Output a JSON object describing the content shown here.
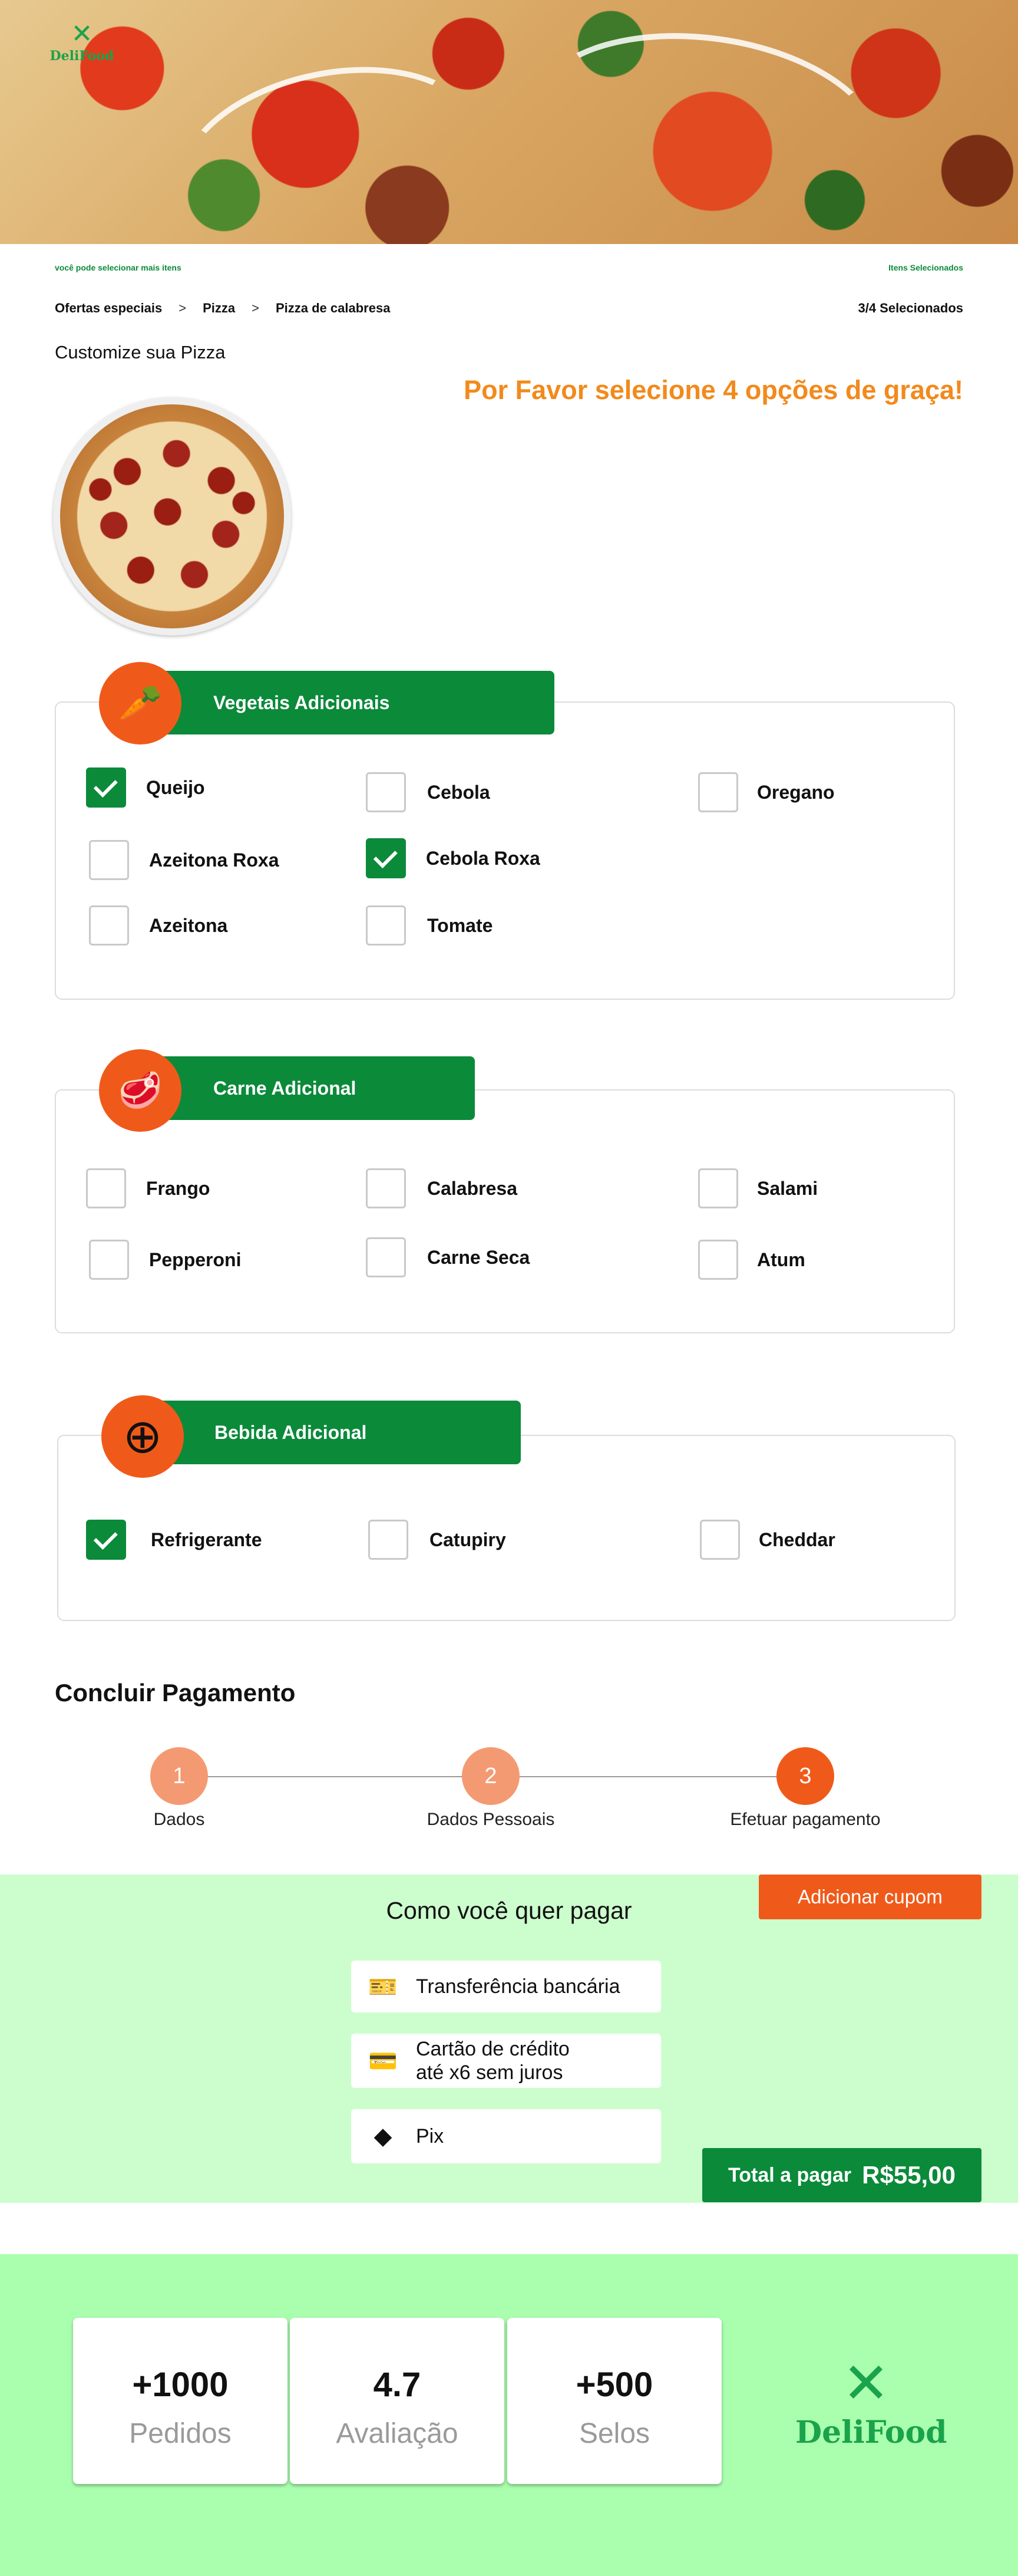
{
  "brand": {
    "name": "DeliFood",
    "logo_icon": "fork-knife-icon",
    "primary_color": "#0b8a3a",
    "accent_color": "#ef5a1a",
    "promo_color": "#f28a1c"
  },
  "header": {
    "hint_left": "você pode selecionar mais itens",
    "hint_right": "Itens Selecionados",
    "breadcrumb": [
      "Ofertas especiais",
      "Pizza",
      "Pizza de calabresa"
    ],
    "counter": "3/4 Selecionados",
    "customize_title": "Customize sua Pizza",
    "promo": "Por Favor selecione 4 opções de graça!"
  },
  "sections": [
    {
      "title": "Vegetais Adicionais",
      "icon": "carrot-icon",
      "options": [
        {
          "label": "Queijo",
          "checked": true
        },
        {
          "label": "Cebola",
          "checked": false
        },
        {
          "label": "Oregano",
          "checked": false
        },
        {
          "label": "Azeitona Roxa",
          "checked": false
        },
        {
          "label": "Cebola Roxa",
          "checked": true
        },
        {
          "label": "Azeitona",
          "checked": false
        },
        {
          "label": "Tomate",
          "checked": false
        }
      ]
    },
    {
      "title": "Carne Adicional",
      "icon": "steak-icon",
      "options": [
        {
          "label": "Frango",
          "checked": false
        },
        {
          "label": "Calabresa",
          "checked": false
        },
        {
          "label": "Salami",
          "checked": false
        },
        {
          "label": "Pepperoni",
          "checked": false
        },
        {
          "label": "Carne Seca",
          "checked": false
        },
        {
          "label": "Atum",
          "checked": false
        }
      ]
    },
    {
      "title": "Bebida Adicional",
      "icon": "plus-circle-icon",
      "options": [
        {
          "label": "Refrigerante",
          "checked": true
        },
        {
          "label": "Catupiry",
          "checked": false
        },
        {
          "label": "Cheddar",
          "checked": false
        }
      ]
    }
  ],
  "payment": {
    "title": "Concluir Pagamento",
    "steps": [
      {
        "number": "1",
        "label": "Dados",
        "state": "done"
      },
      {
        "number": "2",
        "label": "Dados Pessoais",
        "state": "done"
      },
      {
        "number": "3",
        "label": "Efetuar pagamento",
        "state": "active"
      }
    ],
    "coupon_label": "Adicionar cupom",
    "question": "Como você quer pagar",
    "methods": [
      {
        "label": "Transferência bancária",
        "icon": "ticket-icon"
      },
      {
        "label": "Cartão de crédito",
        "label2": "até x6 sem juros",
        "icon": "credit-card-icon"
      },
      {
        "label": "Pix",
        "icon": "pix-icon"
      }
    ],
    "total_label": "Total a pagar",
    "total_value": "R$55,00"
  },
  "footer": {
    "stats": [
      {
        "value": "+1000",
        "label": "Pedidos"
      },
      {
        "value": "4.7",
        "label": "Avaliação"
      },
      {
        "value": "+500",
        "label": "Selos"
      }
    ],
    "logo_text": "DeliFood"
  }
}
